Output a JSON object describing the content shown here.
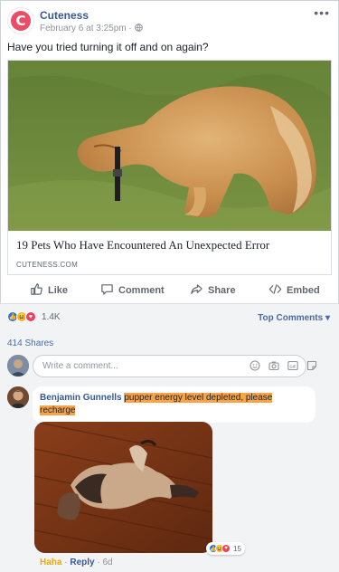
{
  "post": {
    "page_name": "Cuteness",
    "page_logo_letter": "C",
    "meta_time": "February 6 at 3:25pm",
    "meta_sep": "·",
    "text": "Have you tried turning it off and on again?",
    "link_title": "19 Pets Who Have Encountered An Unexpected Error",
    "link_domain": "CUTENESS.COM"
  },
  "actions": {
    "like": "Like",
    "comment": "Comment",
    "share": "Share",
    "embed": "Embed"
  },
  "stats": {
    "reaction_count": "1.4K",
    "top_comments": "Top Comments",
    "shares": "414 Shares"
  },
  "composer": {
    "placeholder": "Write a comment..."
  },
  "comment": {
    "author": "Benjamin Gunnells",
    "text": "pupper energy level depleted, please recharge",
    "reaction_count": "15",
    "haha": "Haha",
    "reply": "Reply",
    "age": "6d",
    "sep": "·"
  },
  "colors": {
    "brand": "#ea4d68",
    "link_blue": "#385898",
    "highlight": "#f6a44a",
    "like_blue": "#1877f2",
    "love_red": "#f33e58",
    "haha_yellow": "#f7b125"
  },
  "icons": [
    "more-icon",
    "globe-icon",
    "like-icon",
    "comment-icon",
    "share-icon",
    "embed-icon",
    "emoji-icon",
    "camera-icon",
    "gif-icon",
    "sticker-icon",
    "chevron-down-icon"
  ]
}
